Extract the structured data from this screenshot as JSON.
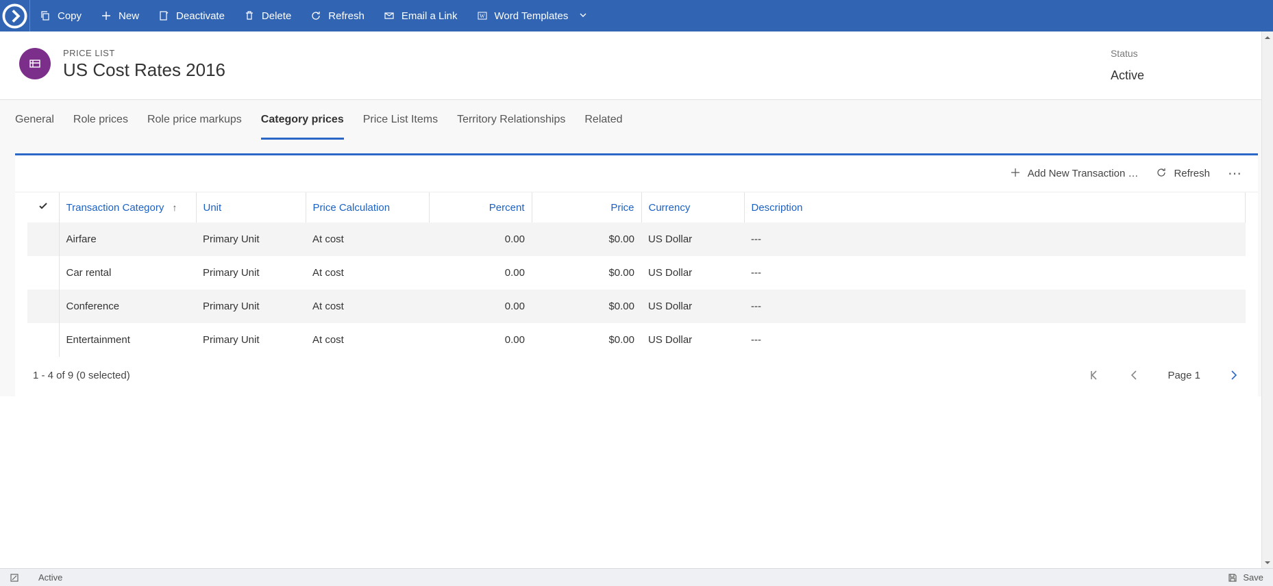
{
  "commandBar": {
    "copy": "Copy",
    "new": "New",
    "deactivate": "Deactivate",
    "delete": "Delete",
    "refresh": "Refresh",
    "emailLink": "Email a Link",
    "wordTemplates": "Word Templates"
  },
  "header": {
    "entity": "PRICE LIST",
    "title": "US Cost Rates 2016",
    "statusLabel": "Status",
    "statusValue": "Active"
  },
  "tabs": {
    "general": "General",
    "rolePrices": "Role prices",
    "rolePriceMarkups": "Role price markups",
    "categoryPrices": "Category prices",
    "priceListItems": "Price List Items",
    "territoryRelationships": "Territory Relationships",
    "related": "Related"
  },
  "gridToolbar": {
    "addNew": "Add New Transaction …",
    "refresh": "Refresh"
  },
  "columns": {
    "transactionCategory": "Transaction Category",
    "unit": "Unit",
    "priceCalculation": "Price Calculation",
    "percent": "Percent",
    "price": "Price",
    "currency": "Currency",
    "description": "Description"
  },
  "rows": [
    {
      "category": "Airfare",
      "unit": "Primary Unit",
      "calc": "At cost",
      "percent": "0.00",
      "price": "$0.00",
      "currency": "US Dollar",
      "description": "---"
    },
    {
      "category": "Car rental",
      "unit": "Primary Unit",
      "calc": "At cost",
      "percent": "0.00",
      "price": "$0.00",
      "currency": "US Dollar",
      "description": "---"
    },
    {
      "category": "Conference",
      "unit": "Primary Unit",
      "calc": "At cost",
      "percent": "0.00",
      "price": "$0.00",
      "currency": "US Dollar",
      "description": "---"
    },
    {
      "category": "Entertainment",
      "unit": "Primary Unit",
      "calc": "At cost",
      "percent": "0.00",
      "price": "$0.00",
      "currency": "US Dollar",
      "description": "---"
    }
  ],
  "gridFooter": {
    "summary": "1 - 4 of 9 (0 selected)",
    "page": "Page 1"
  },
  "statusBar": {
    "state": "Active",
    "save": "Save"
  }
}
